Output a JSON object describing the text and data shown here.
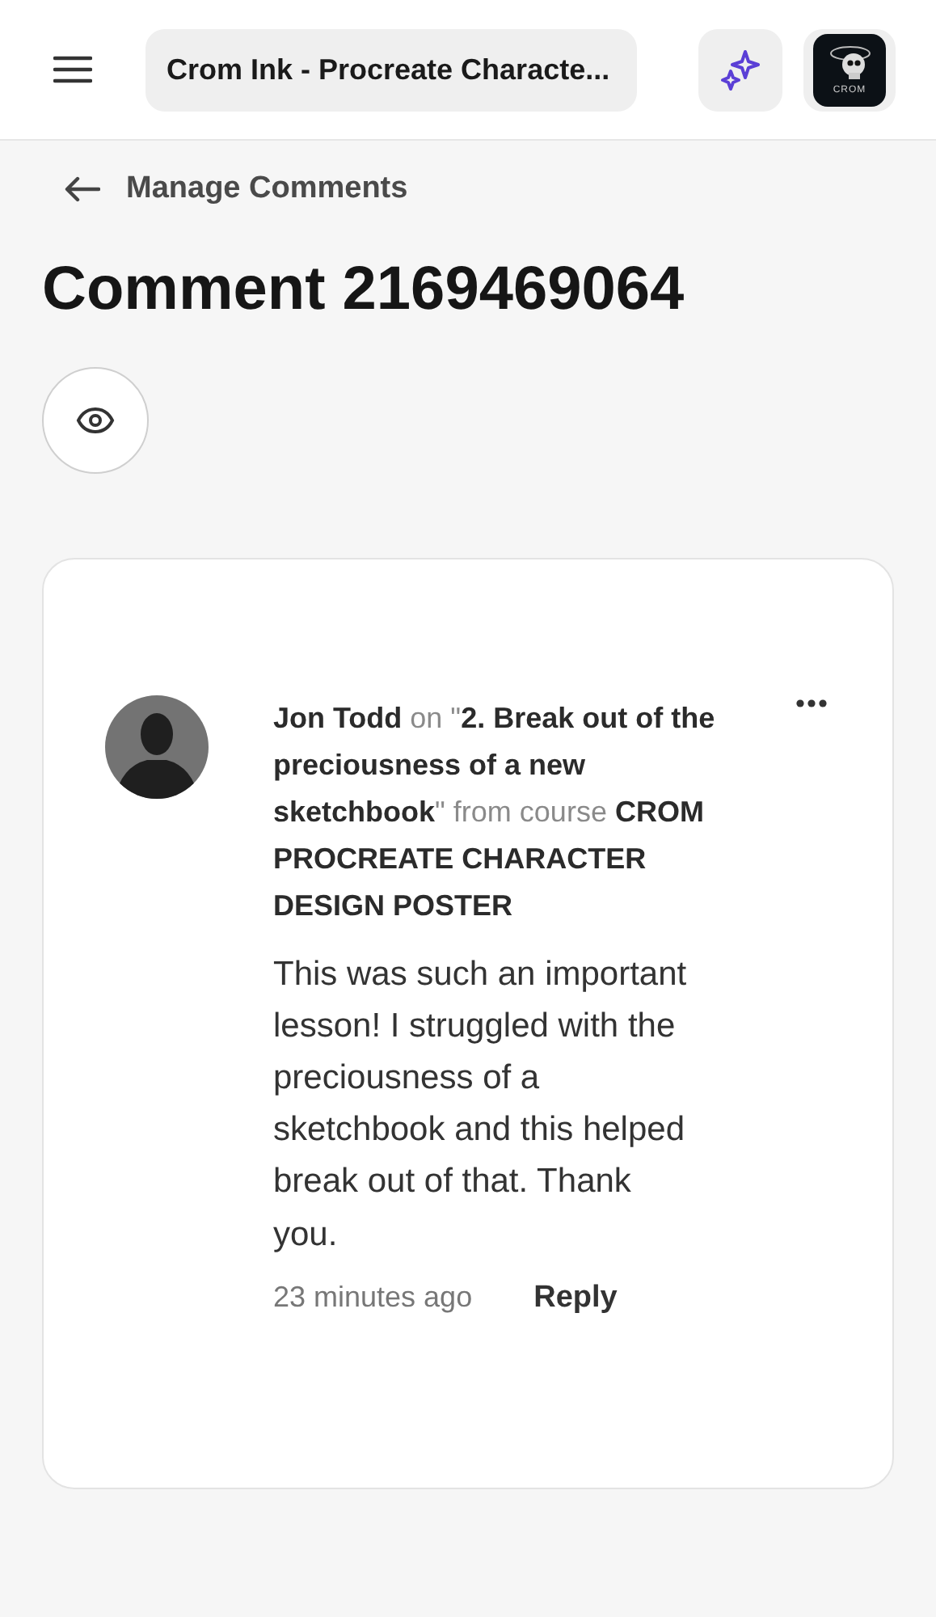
{
  "top_bar": {
    "title": "Crom Ink - Procreate Characte...",
    "logo_text": "CROM"
  },
  "back_link": {
    "label": "Manage Comments"
  },
  "page_title": "Comment 2169469064",
  "comment": {
    "context": "**Jon Todd** on \"**2. Break out of the preciousness of a new sketchbook**\" from course **CROM PROCREATE CHARACTER DESIGN POSTER**",
    "body": "This was such an important lesson! I struggled with the preciousness of a sketchbook and this helped break out of that. Thank you.",
    "time": "23 minutes ago",
    "reply": "Reply"
  }
}
